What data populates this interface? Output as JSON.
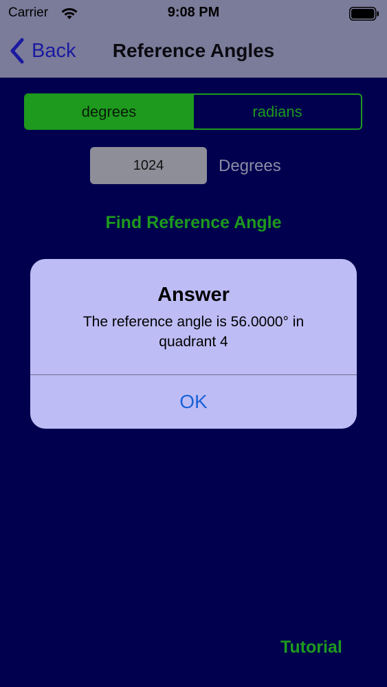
{
  "status_bar": {
    "carrier": "Carrier",
    "time": "9:08 PM",
    "icons": [
      "wifi-icon",
      "battery-icon"
    ]
  },
  "nav": {
    "back_label": "Back",
    "title": "Reference Angles"
  },
  "segment": {
    "options": [
      "degrees",
      "radians"
    ],
    "selected": "degrees"
  },
  "angle_input": {
    "value": "1024",
    "unit_label": "Degrees"
  },
  "find_button_label": "Find Reference Angle",
  "tutorial_label": "Tutorial",
  "alert": {
    "title": "Answer",
    "message": "The reference angle is 56.0000° in quadrant 4",
    "button_label": "OK"
  },
  "colors": {
    "background": "#00004e",
    "accent_green": "#1e9a1e",
    "alert_background": "#bdbcf5",
    "link_blue": "#1a62d8"
  }
}
